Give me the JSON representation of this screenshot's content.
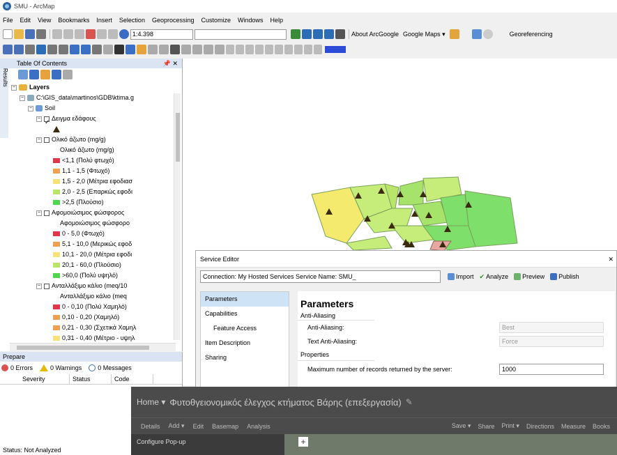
{
  "window": {
    "title": "SMU - ArcMap"
  },
  "menu": [
    "File",
    "Edit",
    "View",
    "Bookmarks",
    "Insert",
    "Selection",
    "Geoprocessing",
    "Customize",
    "Windows",
    "Help"
  ],
  "toolbar": {
    "scale": "1:4.398",
    "arcgoogle": "About ArcGoogle",
    "googlemaps": "Google Maps ▾",
    "georef": "Georeferencing"
  },
  "toc": {
    "title": "Table Of Contents",
    "side_tab": "Results",
    "layers": "Layers",
    "path": "C:\\GIS_data\\martinos\\GDB\\ktima.g",
    "group": "Soil",
    "sample_layer": "Δειγμα εδάφους",
    "nitrogen": {
      "name": "Ολικό άζωτο (mg/g)",
      "sub": "Ολικό άζωτο (mg/g)",
      "classes": [
        {
          "label": "<1,1 (Πολύ φτωχό)",
          "color": "#e0384a"
        },
        {
          "label": "1,1 - 1,5 (Φτωχό)",
          "color": "#f0a050"
        },
        {
          "label": "1,5 - 2,0 (Μέτρια εφοδιασ",
          "color": "#f5e37a"
        },
        {
          "label": "2,0 - 2,5 (Επαρκώς εφοδι",
          "color": "#b9e56b"
        },
        {
          "label": ">2,5 (Πλούσιο)",
          "color": "#4fd84f"
        }
      ]
    },
    "phosphorus": {
      "name": "Αφομοιώσιμος φώσφορος",
      "sub": "Αφομοιώσιμος φώσφορο",
      "classes": [
        {
          "label": "0 - 5,0 (Φτωχό)",
          "color": "#e0384a"
        },
        {
          "label": "5,1 - 10,0 (Μερικώς εφοδ",
          "color": "#f0a050"
        },
        {
          "label": "10,1 - 20,0 (Μέτρια εφοδι",
          "color": "#f5e37a"
        },
        {
          "label": "20,1 - 60,0 (Πλούσιο)",
          "color": "#b9e56b"
        },
        {
          "label": ">60,0 (Πολύ υψηλό)",
          "color": "#4fd84f"
        }
      ]
    },
    "potassium": {
      "name": "Ανταλλάξιμο κάλιο (meq/10",
      "sub": "Ανταλλάξιμο κάλιο (meq",
      "classes": [
        {
          "label": "0 - 0,10 (Πολύ Χαμηλό)",
          "color": "#e0384a"
        },
        {
          "label": "0,10 - 0,20 (Χαμηλό)",
          "color": "#f0a050"
        },
        {
          "label": "0,21 - 0,30 (Σχετικά Χαμηλ",
          "color": "#f0a050"
        },
        {
          "label": "0,31 - 0,40 (Μέτριο - υψηλ",
          "color": "#f5e37a"
        }
      ]
    }
  },
  "prepare": {
    "title": "Prepare",
    "errors": "0 Errors",
    "warnings": "0 Warnings",
    "messages": "0 Messages",
    "cols": [
      "Severity",
      "Status",
      "Code"
    ],
    "status": "Status: Not Analyzed"
  },
  "service_editor": {
    "title": "Service Editor",
    "connection": "Connection: My Hosted Services  Service Name: SMU_",
    "buttons": {
      "import": "Import",
      "analyze": "Analyze",
      "preview": "Preview",
      "publish": "Publish"
    },
    "nav": [
      "Parameters",
      "Capabilities",
      "Feature Access",
      "Item Description",
      "Sharing"
    ],
    "heading": "Parameters",
    "antialiasing_group": "Anti-Aliasing",
    "antialiasing_label": "Anti-Aliasing:",
    "antialiasing_value": "Best",
    "text_aa_label": "Text Anti-Aliasing:",
    "text_aa_value": "Force",
    "properties_group": "Properties",
    "maxrec_label": "Maximum number of records returned by the server:",
    "maxrec_value": "1000"
  },
  "online": {
    "home": "Home ▾",
    "title": "Φυτοθγειονομικός έλεγχος κτήματος Βάρης (επεξεργασία)",
    "tools": [
      "Details",
      "Add ▾",
      "Edit",
      "Basemap",
      "Analysis"
    ],
    "right_tools": [
      "Save ▾",
      "Share",
      "Print ▾",
      "Directions",
      "Measure",
      "Books"
    ],
    "configure": "Configure Pop-up"
  }
}
